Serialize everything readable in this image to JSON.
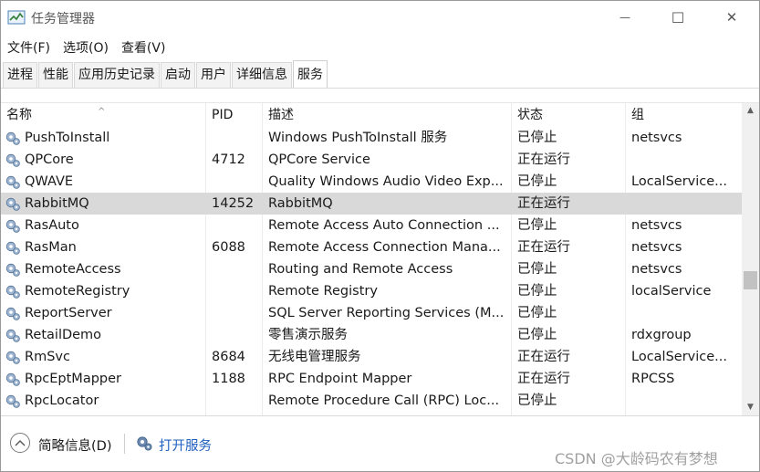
{
  "window": {
    "title": "任务管理器",
    "minimize_glyph": "—",
    "maximize_glyph": "☐",
    "close_glyph": "✕"
  },
  "menu": [
    "文件(F)",
    "选项(O)",
    "查看(V)"
  ],
  "tabs": [
    {
      "label": "进程",
      "active": false
    },
    {
      "label": "性能",
      "active": false
    },
    {
      "label": "应用历史记录",
      "active": false
    },
    {
      "label": "启动",
      "active": false
    },
    {
      "label": "用户",
      "active": false
    },
    {
      "label": "详细信息",
      "active": false
    },
    {
      "label": "服务",
      "active": true
    }
  ],
  "columns": {
    "name": "名称",
    "pid": "PID",
    "desc": "描述",
    "status": "状态",
    "group": "组",
    "sort_indicator": "^"
  },
  "services": [
    {
      "name": "PushToInstall",
      "pid": "",
      "desc": "Windows PushToInstall 服务",
      "status": "已停止",
      "group": "netsvcs"
    },
    {
      "name": "QPCore",
      "pid": "4712",
      "desc": "QPCore Service",
      "status": "正在运行",
      "group": ""
    },
    {
      "name": "QWAVE",
      "pid": "",
      "desc": "Quality Windows Audio Video Exp...",
      "status": "已停止",
      "group": "LocalService..."
    },
    {
      "name": "RabbitMQ",
      "pid": "14252",
      "desc": "RabbitMQ",
      "status": "正在运行",
      "group": "",
      "selected": true
    },
    {
      "name": "RasAuto",
      "pid": "",
      "desc": "Remote Access Auto Connection ...",
      "status": "已停止",
      "group": "netsvcs"
    },
    {
      "name": "RasMan",
      "pid": "6088",
      "desc": "Remote Access Connection Mana...",
      "status": "正在运行",
      "group": "netsvcs"
    },
    {
      "name": "RemoteAccess",
      "pid": "",
      "desc": "Routing and Remote Access",
      "status": "已停止",
      "group": "netsvcs"
    },
    {
      "name": "RemoteRegistry",
      "pid": "",
      "desc": "Remote Registry",
      "status": "已停止",
      "group": "localService"
    },
    {
      "name": "ReportServer",
      "pid": "",
      "desc": "SQL Server Reporting Services (M...",
      "status": "已停止",
      "group": ""
    },
    {
      "name": "RetailDemo",
      "pid": "",
      "desc": "零售演示服务",
      "status": "已停止",
      "group": "rdxgroup"
    },
    {
      "name": "RmSvc",
      "pid": "8684",
      "desc": "无线电管理服务",
      "status": "正在运行",
      "group": "LocalService..."
    },
    {
      "name": "RpcEptMapper",
      "pid": "1188",
      "desc": "RPC Endpoint Mapper",
      "status": "正在运行",
      "group": "RPCSS"
    },
    {
      "name": "RpcLocator",
      "pid": "",
      "desc": "Remote Procedure Call (RPC) Loc...",
      "status": "已停止",
      "group": ""
    }
  ],
  "scrollbar": {
    "position_fraction": 0.58
  },
  "footer": {
    "fewer_details": "简略信息(D)",
    "open_services": "打开服务"
  },
  "watermark": "CSDN @大龄码农有梦想",
  "colors": {
    "selected_row": "#d9d9d9",
    "link": "#1f5fbf"
  }
}
